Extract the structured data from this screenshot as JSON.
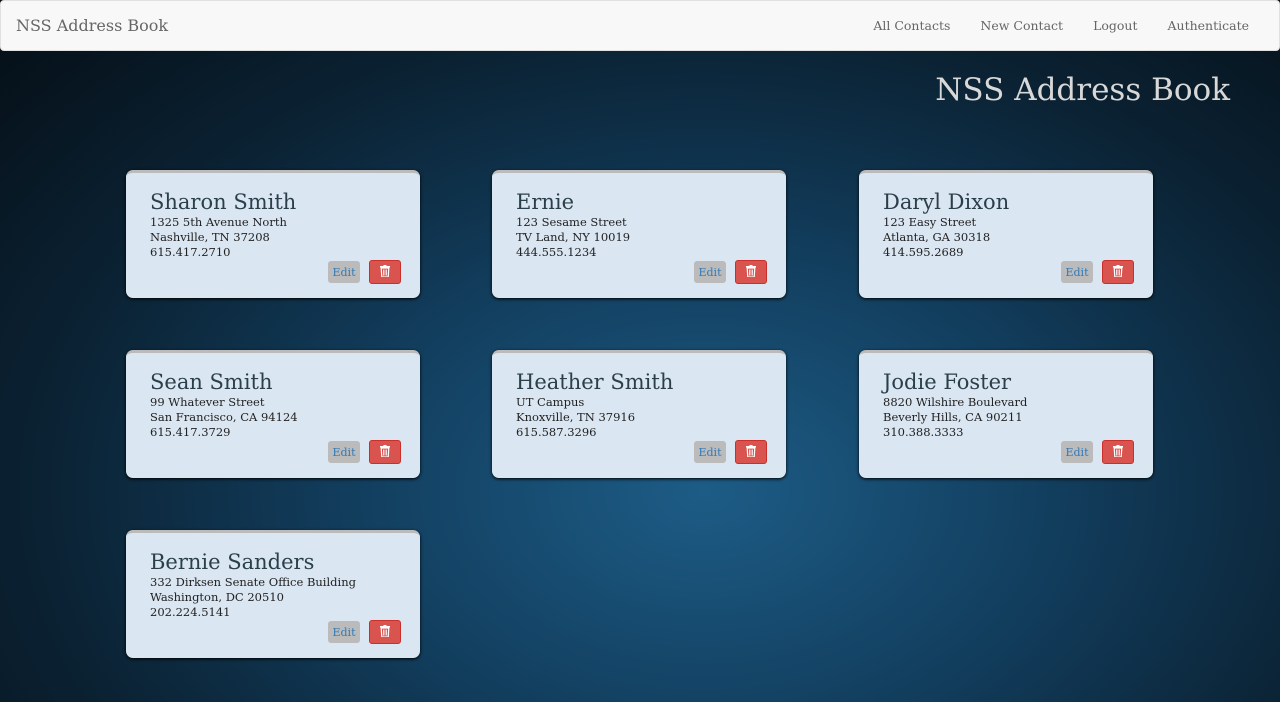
{
  "nav": {
    "brand": "NSS Address Book",
    "links": [
      "All Contacts",
      "New Contact",
      "Logout",
      "Authenticate"
    ]
  },
  "heading": "NSS Address Book",
  "edit_label": "Edit",
  "delete_icon": "trash-icon",
  "contacts": [
    {
      "name": "Sharon Smith",
      "street": "1325 5th Avenue North",
      "city": "Nashville, TN 37208",
      "phone": "615.417.2710"
    },
    {
      "name": "Ernie",
      "street": "123 Sesame Street",
      "city": "TV Land, NY 10019",
      "phone": "444.555.1234"
    },
    {
      "name": "Daryl Dixon",
      "street": "123 Easy Street",
      "city": "Atlanta, GA 30318",
      "phone": "414.595.2689"
    },
    {
      "name": "Sean Smith",
      "street": "99 Whatever Street",
      "city": "San Francisco, CA 94124",
      "phone": "615.417.3729"
    },
    {
      "name": "Heather Smith",
      "street": "UT Campus",
      "city": "Knoxville, TN 37916",
      "phone": "615.587.3296"
    },
    {
      "name": "Jodie Foster",
      "street": "8820 Wilshire Boulevard",
      "city": "Beverly Hills, CA 90211",
      "phone": "310.388.3333"
    },
    {
      "name": "Bernie Sanders",
      "street": "332 Dirksen Senate Office Building",
      "city": "Washington, DC 20510",
      "phone": "202.224.5141"
    }
  ]
}
